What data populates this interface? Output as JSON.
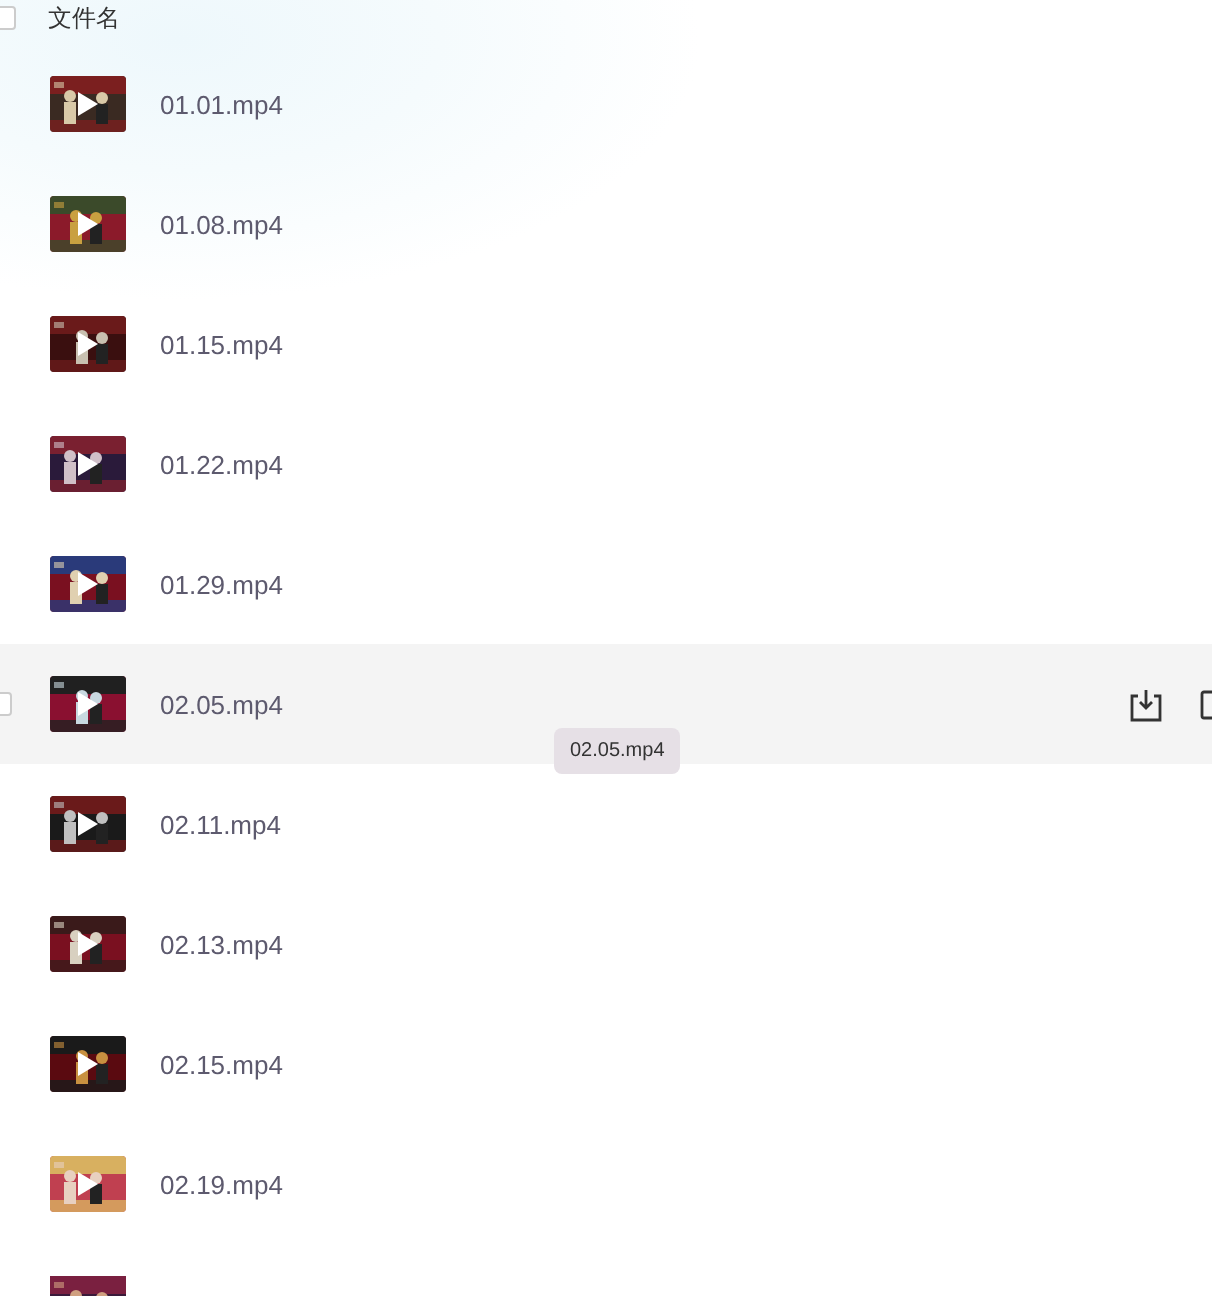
{
  "header": {
    "label": "文件名",
    "checked": false
  },
  "files": [
    {
      "name": "01.01.mp4",
      "hovered": false
    },
    {
      "name": "01.08.mp4",
      "hovered": false
    },
    {
      "name": "01.15.mp4",
      "hovered": false
    },
    {
      "name": "01.22.mp4",
      "hovered": false
    },
    {
      "name": "01.29.mp4",
      "hovered": false
    },
    {
      "name": "02.05.mp4",
      "hovered": true,
      "checked": false,
      "tooltip": "02.05.mp4"
    },
    {
      "name": "02.11.mp4",
      "hovered": false
    },
    {
      "name": "02.13.mp4",
      "hovered": false
    },
    {
      "name": "02.15.mp4",
      "hovered": false
    },
    {
      "name": "02.19.mp4",
      "hovered": false
    }
  ],
  "more_below": true
}
